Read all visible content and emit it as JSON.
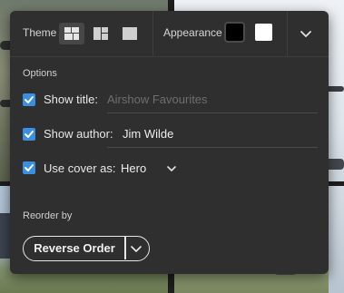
{
  "toolbar": {
    "theme_label": "Theme",
    "appearance_label": "Appearance",
    "theme_options": [
      {
        "icon": "grid-layout-icon",
        "selected": true
      },
      {
        "icon": "split-layout-icon",
        "selected": false
      },
      {
        "icon": "single-layout-icon",
        "selected": false
      }
    ],
    "appearance_options": [
      {
        "icon": "dark-swatch",
        "color": "#000000",
        "selected": true
      },
      {
        "icon": "light-swatch",
        "color": "#ffffff",
        "selected": false
      }
    ],
    "collapse_icon": "chevron-down-icon"
  },
  "options": {
    "section_title": "Options",
    "show_title": {
      "label": "Show title:",
      "checked": true,
      "value": "",
      "placeholder": "Airshow Favourites"
    },
    "show_author": {
      "label": "Show author:",
      "checked": true,
      "value": "Jim Wilde"
    },
    "use_cover": {
      "label": "Use cover as:",
      "checked": true,
      "value": "Hero"
    }
  },
  "reorder": {
    "section_title": "Reorder by",
    "button_label": "Reverse Order",
    "dropdown_icon": "chevron-down-icon"
  },
  "colors": {
    "panel_bg": "#2f2f2f",
    "accent": "#3a8fe0",
    "text": "#e8e8e8",
    "placeholder": "#6e6e6e"
  }
}
